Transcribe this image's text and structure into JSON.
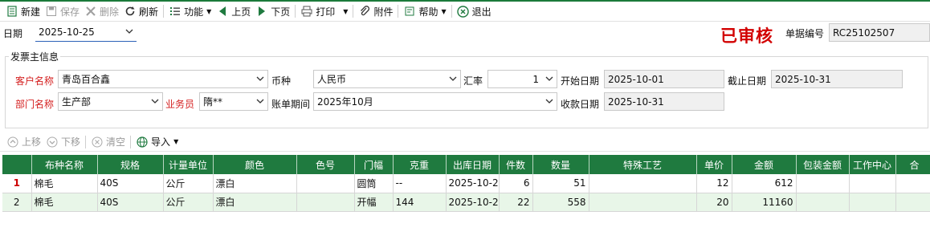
{
  "toolbar": {
    "new": "新建",
    "save": "保存",
    "delete": "删除",
    "refresh": "刷新",
    "function": "功能",
    "prev": "上页",
    "next": "下页",
    "print": "打印",
    "attachment": "附件",
    "help": "帮助",
    "exit": "退出"
  },
  "header": {
    "date_label": "日期",
    "date_value": "2025-10-25",
    "stamp": "已审核",
    "doc_no_label": "单据编号",
    "doc_no_value": "RC25102507"
  },
  "invoice": {
    "group_title": "发票主信息",
    "customer_label": "客户名称",
    "customer_value": "青岛百合鑫",
    "currency_label": "币种",
    "currency_value": "人民币",
    "rate_label": "汇率",
    "rate_value": "1",
    "start_label": "开始日期",
    "start_value": "2025-10-01",
    "end_label": "截止日期",
    "end_value": "2025-10-31",
    "dept_label": "部门名称",
    "dept_value": "生产部",
    "salesman_label": "业务员",
    "salesman_value": "隋**",
    "period_label": "账单期间",
    "period_value": "2025年10月",
    "collect_label": "收款日期",
    "collect_value": "2025-10-31"
  },
  "subtoolbar": {
    "up": "上移",
    "down": "下移",
    "clear": "清空",
    "import": "导入"
  },
  "grid": {
    "columns": [
      "",
      "布种名称",
      "规格",
      "计量单位",
      "颜色",
      "色号",
      "门幅",
      "克重",
      "出库日期",
      "件数",
      "数量",
      "特殊工艺",
      "单价",
      "金额",
      "包装金额",
      "工作中心",
      "合"
    ],
    "rows": [
      [
        "1",
        "棉毛",
        "40S",
        "公斤",
        "漂白",
        "",
        "圆筒",
        "--",
        "2025-10-2",
        "6",
        "51",
        "",
        "12",
        "612",
        "",
        "",
        ""
      ],
      [
        "2",
        "棉毛",
        "40S",
        "公斤",
        "漂白",
        "",
        "开幅",
        "144",
        "2025-10-2",
        "22",
        "558",
        "",
        "20",
        "11160",
        "",
        "",
        ""
      ]
    ]
  },
  "colors": {
    "accent": "#1f7a3f",
    "stamp": "#d20000",
    "required_label": "#d41e1e"
  }
}
